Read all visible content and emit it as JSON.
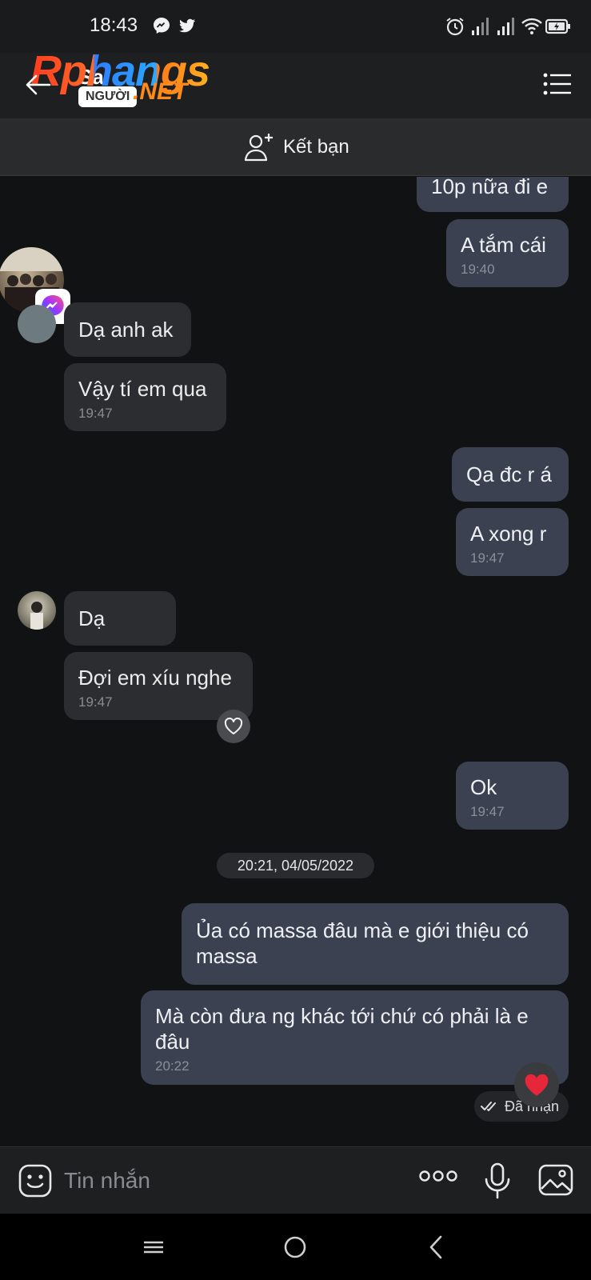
{
  "status_bar": {
    "time": "18:43"
  },
  "header": {
    "name": "Sa",
    "watermark": {
      "main": "Rphangs",
      "pill": "NGƯỜI",
      "suffix": ".NET"
    }
  },
  "friend_bar": {
    "label": "Kết bạn"
  },
  "messages": [
    {
      "side": "out",
      "text": "10p nữa đi e",
      "time": ""
    },
    {
      "side": "out",
      "text": "A tắm cái",
      "time": "19:40"
    },
    {
      "side": "in",
      "text": "Dạ anh ak",
      "time": ""
    },
    {
      "side": "in",
      "text": "Vậy tí em qua",
      "time": "19:47"
    },
    {
      "side": "out",
      "text": "Qa đc r á",
      "time": ""
    },
    {
      "side": "out",
      "text": "A xong r",
      "time": "19:47"
    },
    {
      "side": "in",
      "text": "Dạ",
      "time": ""
    },
    {
      "side": "in",
      "text": "Đợi em xíu nghe",
      "time": "19:47"
    },
    {
      "side": "out",
      "text": "Ok",
      "time": "19:47"
    },
    {
      "side": "out",
      "text": "Ủa có massa đâu mà e giới thiệu có massa",
      "time": ""
    },
    {
      "side": "out",
      "text": "Mà còn đưa ng khác tới chứ có phải là e đâu",
      "time": "20:22"
    }
  ],
  "date_separator": "20:21, 04/05/2022",
  "receipt": {
    "label": "Đã nhận"
  },
  "input": {
    "placeholder": "Tin nhắn"
  },
  "colors": {
    "incoming": "#2c2d30",
    "outgoing": "#3b4150",
    "background": "#111213"
  }
}
